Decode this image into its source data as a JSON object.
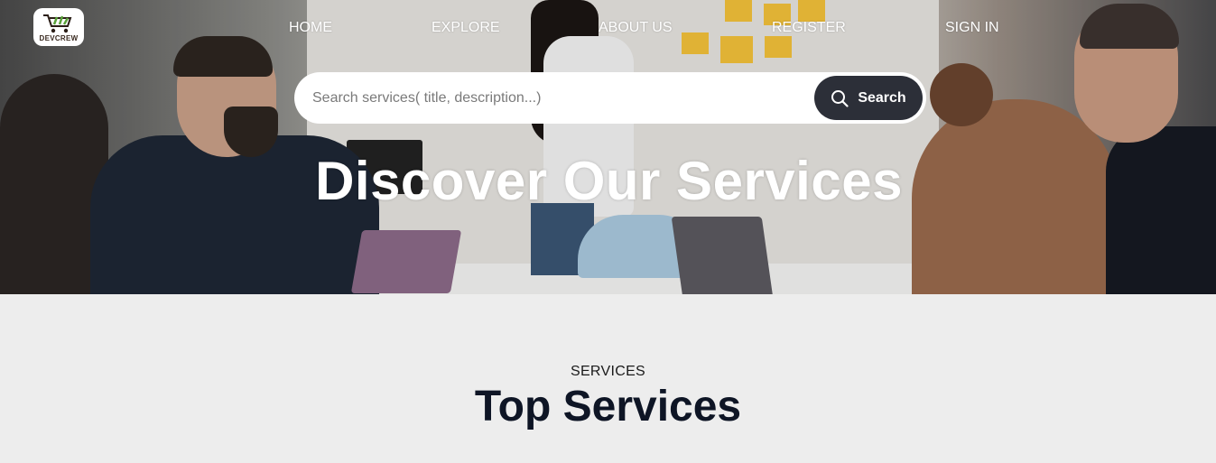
{
  "brand": {
    "logo_text": "DEVCREW"
  },
  "nav": {
    "items": [
      {
        "label": "HOME"
      },
      {
        "label": "EXPLORE"
      },
      {
        "label": "ABOUT US"
      },
      {
        "label": "REGISTER"
      },
      {
        "label": "SIGN IN"
      }
    ]
  },
  "search": {
    "placeholder": "Search services( title, description...)",
    "value": "",
    "button_label": "Search"
  },
  "hero": {
    "title": "Discover Our Services"
  },
  "services": {
    "kicker": "SERVICES",
    "title": "Top Services"
  },
  "colors": {
    "search_button": "#2c2f38",
    "section_background": "#ededed",
    "section_title": "#0e1525"
  }
}
